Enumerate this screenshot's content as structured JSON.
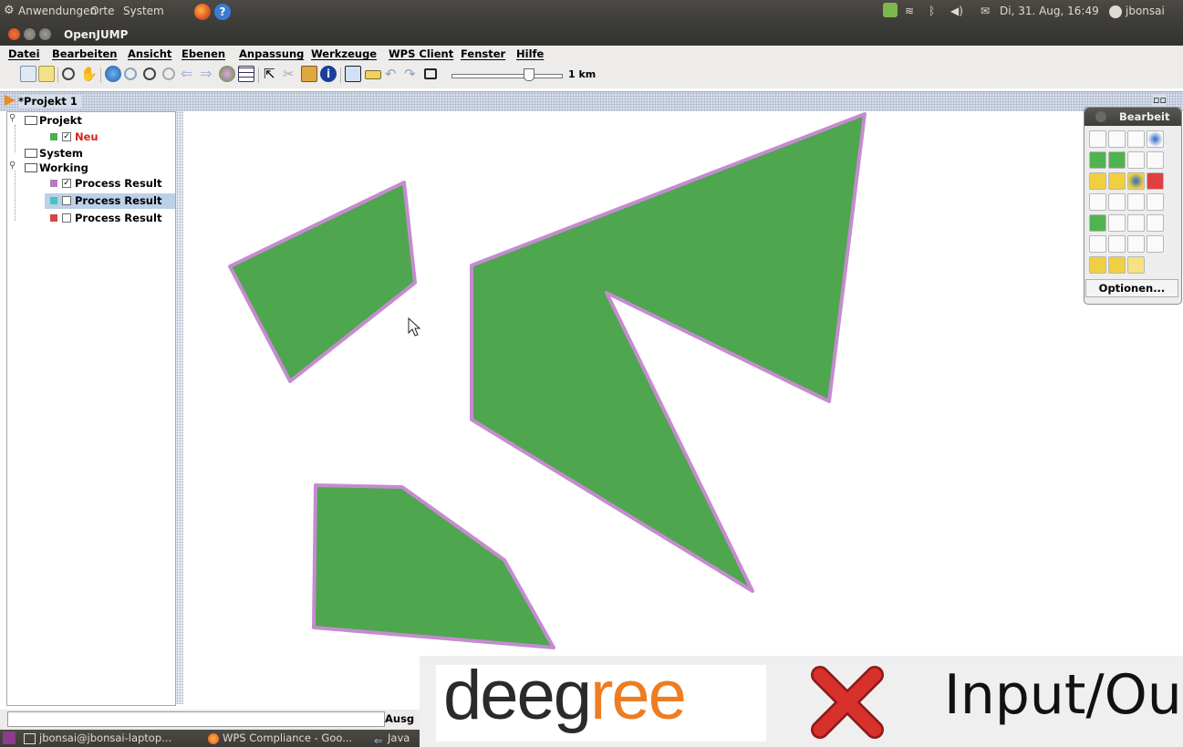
{
  "top_panel": {
    "menus": [
      "Anwendungen",
      "Orte",
      "System"
    ],
    "datetime": "Di, 31. Aug, 16:49",
    "user": "jbonsai"
  },
  "window": {
    "title": "OpenJUMP"
  },
  "menubar": {
    "items": [
      "Datei",
      "Bearbeiten",
      "Ansicht",
      "Ebenen",
      "Anpassung",
      "Werkzeuge",
      "WPS Client",
      "Fenster",
      "Hilfe"
    ]
  },
  "toolbar": {
    "scale_label": "1 km"
  },
  "project": {
    "title": "*Projekt 1",
    "tree": [
      {
        "label": "Projekt",
        "type": "category"
      },
      {
        "label": "Neu",
        "type": "layer",
        "checked": true,
        "color": "#4caf50"
      },
      {
        "label": "System",
        "type": "category"
      },
      {
        "label": "Working",
        "type": "category"
      },
      {
        "label": "Process Result",
        "type": "layer",
        "checked": true,
        "color": "#b57cc0"
      },
      {
        "label": "Process Result",
        "type": "layer",
        "checked": false,
        "color": "#44c4c4",
        "selected": true
      },
      {
        "label": "Process Result",
        "type": "layer",
        "checked": false,
        "color": "#d64545"
      }
    ]
  },
  "map": {
    "fill_color": "#4ea64e",
    "stroke_color": "#c58bcf"
  },
  "edit_toolbox": {
    "title": "Bearbeit",
    "options_label": "Optionen..."
  },
  "statusbar": {
    "output_label": "Ausg"
  },
  "taskbar": {
    "tasks": [
      "jbonsai@jbonsai-laptop...",
      "WPS Compliance - Goo...",
      "Java"
    ]
  },
  "banner": {
    "logo_dark": "deeg",
    "logo_orange": "ree",
    "text": "Input/Ou"
  }
}
